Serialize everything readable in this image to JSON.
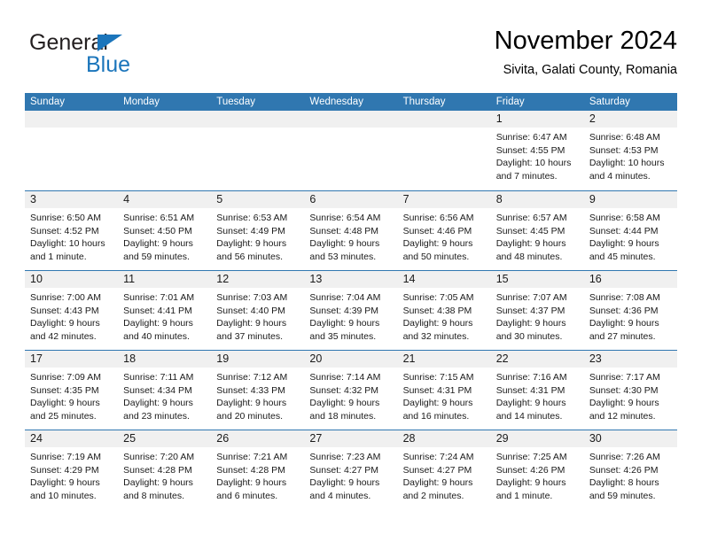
{
  "logo": {
    "word_top": "General",
    "word_bottom": "Blue",
    "colors": {
      "dark": "#231f20",
      "blue": "#1b75bb"
    }
  },
  "header": {
    "title": "November 2024",
    "subtitle": "Sivita, Galati County, Romania"
  },
  "theme": {
    "header_blue": "#3077b0",
    "daynum_band": "#f0f0f0",
    "text": "#1a1a1a"
  },
  "weekdays": [
    "Sunday",
    "Monday",
    "Tuesday",
    "Wednesday",
    "Thursday",
    "Friday",
    "Saturday"
  ],
  "weeks": [
    [
      {
        "day": "",
        "empty": true
      },
      {
        "day": "",
        "empty": true
      },
      {
        "day": "",
        "empty": true
      },
      {
        "day": "",
        "empty": true
      },
      {
        "day": "",
        "empty": true
      },
      {
        "day": "1",
        "sunrise": "Sunrise: 6:47 AM",
        "sunset": "Sunset: 4:55 PM",
        "daylight": "Daylight: 10 hours and 7 minutes."
      },
      {
        "day": "2",
        "sunrise": "Sunrise: 6:48 AM",
        "sunset": "Sunset: 4:53 PM",
        "daylight": "Daylight: 10 hours and 4 minutes."
      }
    ],
    [
      {
        "day": "3",
        "sunrise": "Sunrise: 6:50 AM",
        "sunset": "Sunset: 4:52 PM",
        "daylight": "Daylight: 10 hours and 1 minute."
      },
      {
        "day": "4",
        "sunrise": "Sunrise: 6:51 AM",
        "sunset": "Sunset: 4:50 PM",
        "daylight": "Daylight: 9 hours and 59 minutes."
      },
      {
        "day": "5",
        "sunrise": "Sunrise: 6:53 AM",
        "sunset": "Sunset: 4:49 PM",
        "daylight": "Daylight: 9 hours and 56 minutes."
      },
      {
        "day": "6",
        "sunrise": "Sunrise: 6:54 AM",
        "sunset": "Sunset: 4:48 PM",
        "daylight": "Daylight: 9 hours and 53 minutes."
      },
      {
        "day": "7",
        "sunrise": "Sunrise: 6:56 AM",
        "sunset": "Sunset: 4:46 PM",
        "daylight": "Daylight: 9 hours and 50 minutes."
      },
      {
        "day": "8",
        "sunrise": "Sunrise: 6:57 AM",
        "sunset": "Sunset: 4:45 PM",
        "daylight": "Daylight: 9 hours and 48 minutes."
      },
      {
        "day": "9",
        "sunrise": "Sunrise: 6:58 AM",
        "sunset": "Sunset: 4:44 PM",
        "daylight": "Daylight: 9 hours and 45 minutes."
      }
    ],
    [
      {
        "day": "10",
        "sunrise": "Sunrise: 7:00 AM",
        "sunset": "Sunset: 4:43 PM",
        "daylight": "Daylight: 9 hours and 42 minutes."
      },
      {
        "day": "11",
        "sunrise": "Sunrise: 7:01 AM",
        "sunset": "Sunset: 4:41 PM",
        "daylight": "Daylight: 9 hours and 40 minutes."
      },
      {
        "day": "12",
        "sunrise": "Sunrise: 7:03 AM",
        "sunset": "Sunset: 4:40 PM",
        "daylight": "Daylight: 9 hours and 37 minutes."
      },
      {
        "day": "13",
        "sunrise": "Sunrise: 7:04 AM",
        "sunset": "Sunset: 4:39 PM",
        "daylight": "Daylight: 9 hours and 35 minutes."
      },
      {
        "day": "14",
        "sunrise": "Sunrise: 7:05 AM",
        "sunset": "Sunset: 4:38 PM",
        "daylight": "Daylight: 9 hours and 32 minutes."
      },
      {
        "day": "15",
        "sunrise": "Sunrise: 7:07 AM",
        "sunset": "Sunset: 4:37 PM",
        "daylight": "Daylight: 9 hours and 30 minutes."
      },
      {
        "day": "16",
        "sunrise": "Sunrise: 7:08 AM",
        "sunset": "Sunset: 4:36 PM",
        "daylight": "Daylight: 9 hours and 27 minutes."
      }
    ],
    [
      {
        "day": "17",
        "sunrise": "Sunrise: 7:09 AM",
        "sunset": "Sunset: 4:35 PM",
        "daylight": "Daylight: 9 hours and 25 minutes."
      },
      {
        "day": "18",
        "sunrise": "Sunrise: 7:11 AM",
        "sunset": "Sunset: 4:34 PM",
        "daylight": "Daylight: 9 hours and 23 minutes."
      },
      {
        "day": "19",
        "sunrise": "Sunrise: 7:12 AM",
        "sunset": "Sunset: 4:33 PM",
        "daylight": "Daylight: 9 hours and 20 minutes."
      },
      {
        "day": "20",
        "sunrise": "Sunrise: 7:14 AM",
        "sunset": "Sunset: 4:32 PM",
        "daylight": "Daylight: 9 hours and 18 minutes."
      },
      {
        "day": "21",
        "sunrise": "Sunrise: 7:15 AM",
        "sunset": "Sunset: 4:31 PM",
        "daylight": "Daylight: 9 hours and 16 minutes."
      },
      {
        "day": "22",
        "sunrise": "Sunrise: 7:16 AM",
        "sunset": "Sunset: 4:31 PM",
        "daylight": "Daylight: 9 hours and 14 minutes."
      },
      {
        "day": "23",
        "sunrise": "Sunrise: 7:17 AM",
        "sunset": "Sunset: 4:30 PM",
        "daylight": "Daylight: 9 hours and 12 minutes."
      }
    ],
    [
      {
        "day": "24",
        "sunrise": "Sunrise: 7:19 AM",
        "sunset": "Sunset: 4:29 PM",
        "daylight": "Daylight: 9 hours and 10 minutes."
      },
      {
        "day": "25",
        "sunrise": "Sunrise: 7:20 AM",
        "sunset": "Sunset: 4:28 PM",
        "daylight": "Daylight: 9 hours and 8 minutes."
      },
      {
        "day": "26",
        "sunrise": "Sunrise: 7:21 AM",
        "sunset": "Sunset: 4:28 PM",
        "daylight": "Daylight: 9 hours and 6 minutes."
      },
      {
        "day": "27",
        "sunrise": "Sunrise: 7:23 AM",
        "sunset": "Sunset: 4:27 PM",
        "daylight": "Daylight: 9 hours and 4 minutes."
      },
      {
        "day": "28",
        "sunrise": "Sunrise: 7:24 AM",
        "sunset": "Sunset: 4:27 PM",
        "daylight": "Daylight: 9 hours and 2 minutes."
      },
      {
        "day": "29",
        "sunrise": "Sunrise: 7:25 AM",
        "sunset": "Sunset: 4:26 PM",
        "daylight": "Daylight: 9 hours and 1 minute."
      },
      {
        "day": "30",
        "sunrise": "Sunrise: 7:26 AM",
        "sunset": "Sunset: 4:26 PM",
        "daylight": "Daylight: 8 hours and 59 minutes."
      }
    ]
  ]
}
